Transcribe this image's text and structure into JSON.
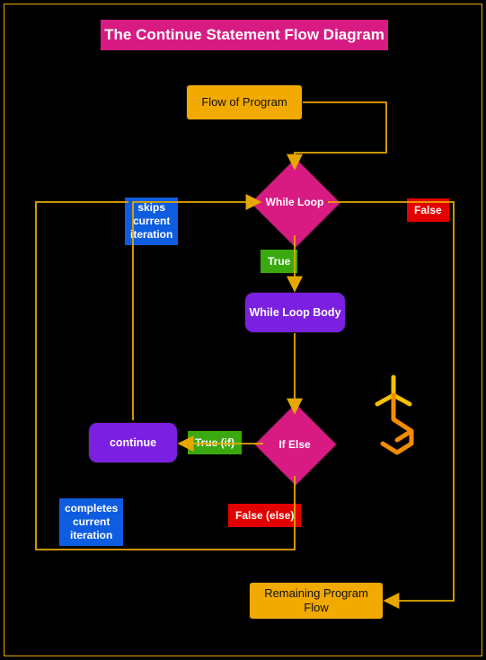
{
  "title": "The Continue Statement Flow Diagram",
  "nodes": {
    "flow_of_program": "Flow of Program",
    "while_loop": "While Loop",
    "while_loop_body": "While Loop Body",
    "if_else": "If Else",
    "continue": "continue",
    "remaining": "Remaining Program\nFlow"
  },
  "edge_labels": {
    "true": "True",
    "false": "False",
    "true_if": "True (if)",
    "false_else": "False (else)"
  },
  "annotations": {
    "skips": "skips\ncurrent\niteration",
    "completes": "completes\ncurrent\niteration"
  },
  "colors": {
    "title_bg": "#d81b82",
    "orange": "#f2a900",
    "purple": "#7b1fe0",
    "green": "#3aa910",
    "red": "#e30000",
    "blue": "#0e5de0",
    "arrow": "#e6a800"
  },
  "chart_data": {
    "type": "flowchart",
    "title": "The Continue Statement Flow Diagram",
    "nodes": [
      {
        "id": "start",
        "label": "Flow of Program",
        "shape": "rect",
        "color": "orange"
      },
      {
        "id": "while",
        "label": "While Loop",
        "shape": "diamond",
        "color": "magenta"
      },
      {
        "id": "body",
        "label": "While Loop Body",
        "shape": "rounded",
        "color": "purple"
      },
      {
        "id": "ifelse",
        "label": "If Else",
        "shape": "diamond",
        "color": "magenta"
      },
      {
        "id": "continue",
        "label": "continue",
        "shape": "rounded",
        "color": "purple"
      },
      {
        "id": "remaining",
        "label": "Remaining Program Flow",
        "shape": "rect",
        "color": "orange"
      }
    ],
    "edges": [
      {
        "from": "start",
        "to": "while",
        "label": ""
      },
      {
        "from": "while",
        "to": "body",
        "label": "True"
      },
      {
        "from": "while",
        "to": "remaining",
        "label": "False"
      },
      {
        "from": "body",
        "to": "ifelse",
        "label": ""
      },
      {
        "from": "ifelse",
        "to": "continue",
        "label": "True (if)",
        "note": "skips current iteration"
      },
      {
        "from": "continue",
        "to": "while",
        "label": ""
      },
      {
        "from": "ifelse",
        "to": "while",
        "label": "False (else)",
        "note": "completes current iteration"
      }
    ]
  }
}
